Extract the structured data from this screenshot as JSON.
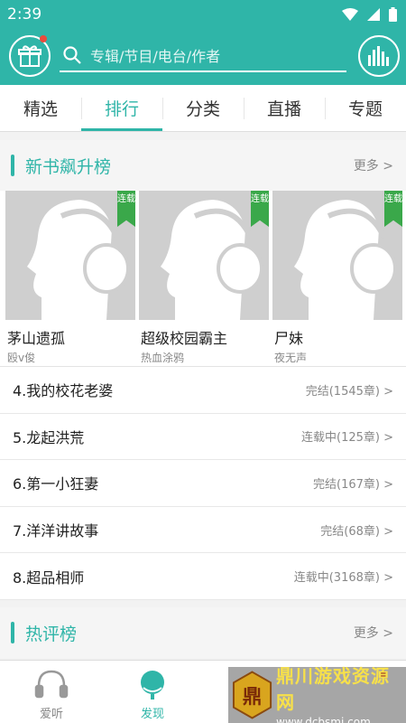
{
  "status_bar": {
    "time": "2:39"
  },
  "search": {
    "placeholder": "专辑/节目/电台/作者"
  },
  "tabs": [
    {
      "label": "精选"
    },
    {
      "label": "排行"
    },
    {
      "label": "分类"
    },
    {
      "label": "直播"
    },
    {
      "label": "专题"
    }
  ],
  "active_tab": "排行",
  "section_new": {
    "title": "新书飙升榜",
    "more": "更多 >"
  },
  "badge_text": "连载",
  "top_books": [
    {
      "title": "茅山遗孤",
      "author": "殴v俊"
    },
    {
      "title": "超级校园霸主",
      "author": "热血涂鸦"
    },
    {
      "title": "尸妹",
      "author": "夜无声"
    }
  ],
  "ranking": [
    {
      "name": "4.我的校花老婆",
      "status": "完结(1545章) >"
    },
    {
      "name": "5.龙起洪荒",
      "status": "连载中(125章) >"
    },
    {
      "name": "6.第一小狂妻",
      "status": "完结(167章) >"
    },
    {
      "name": "7.洋洋讲故事",
      "status": "完结(68章) >"
    },
    {
      "name": "8.超品相师",
      "status": "连载中(3168章) >"
    }
  ],
  "section_hot": {
    "title": "热评榜",
    "more": "更多 >"
  },
  "bottom_nav": [
    {
      "label": "爱听"
    },
    {
      "label": "发现"
    }
  ],
  "watermark": {
    "name": "鼎川游戏资源网",
    "url": "www.dcbsmj.com",
    "logo_char": "鼎"
  },
  "colors": {
    "accent": "#2fb5a8",
    "badge": "#3aa84a",
    "dot": "#e94b3c"
  }
}
